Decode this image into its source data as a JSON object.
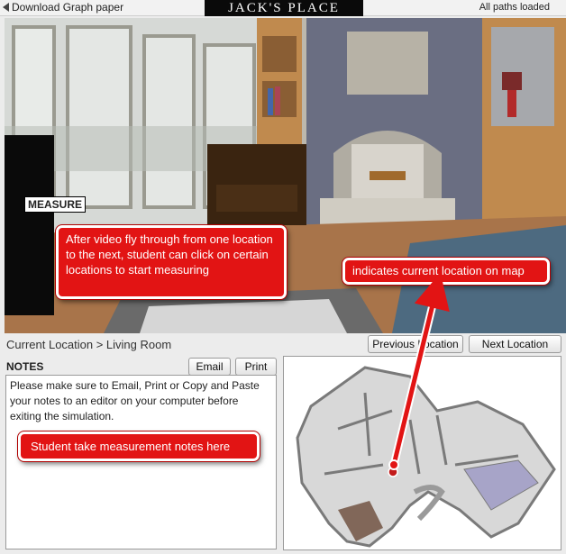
{
  "topbar": {
    "download_label": "Download Graph paper",
    "brand": "JACK'S PLACE",
    "status": "All paths loaded"
  },
  "scene": {
    "measure_label": "MEASURE"
  },
  "callouts": {
    "flythrough": "After video fly through from one location to the next, student can click on certain locations to start measuring",
    "current_location": "indicates current location on map",
    "notes": "Student take measurement notes here"
  },
  "location_bar": {
    "current_location": "Current Location > Living Room",
    "previous_label": "Previous Location",
    "next_label": "Next Location"
  },
  "notes": {
    "title": "NOTES",
    "email_label": "Email",
    "print_label": "Print",
    "text": "Please make sure to Email, Print or Copy and Paste your notes to an editor on your computer before exiting the simulation."
  },
  "colors": {
    "callout": "#e21414",
    "brand_bg": "#0a0a0a"
  },
  "icons": [
    "triangle-left-icon",
    "location-marker-icon"
  ]
}
